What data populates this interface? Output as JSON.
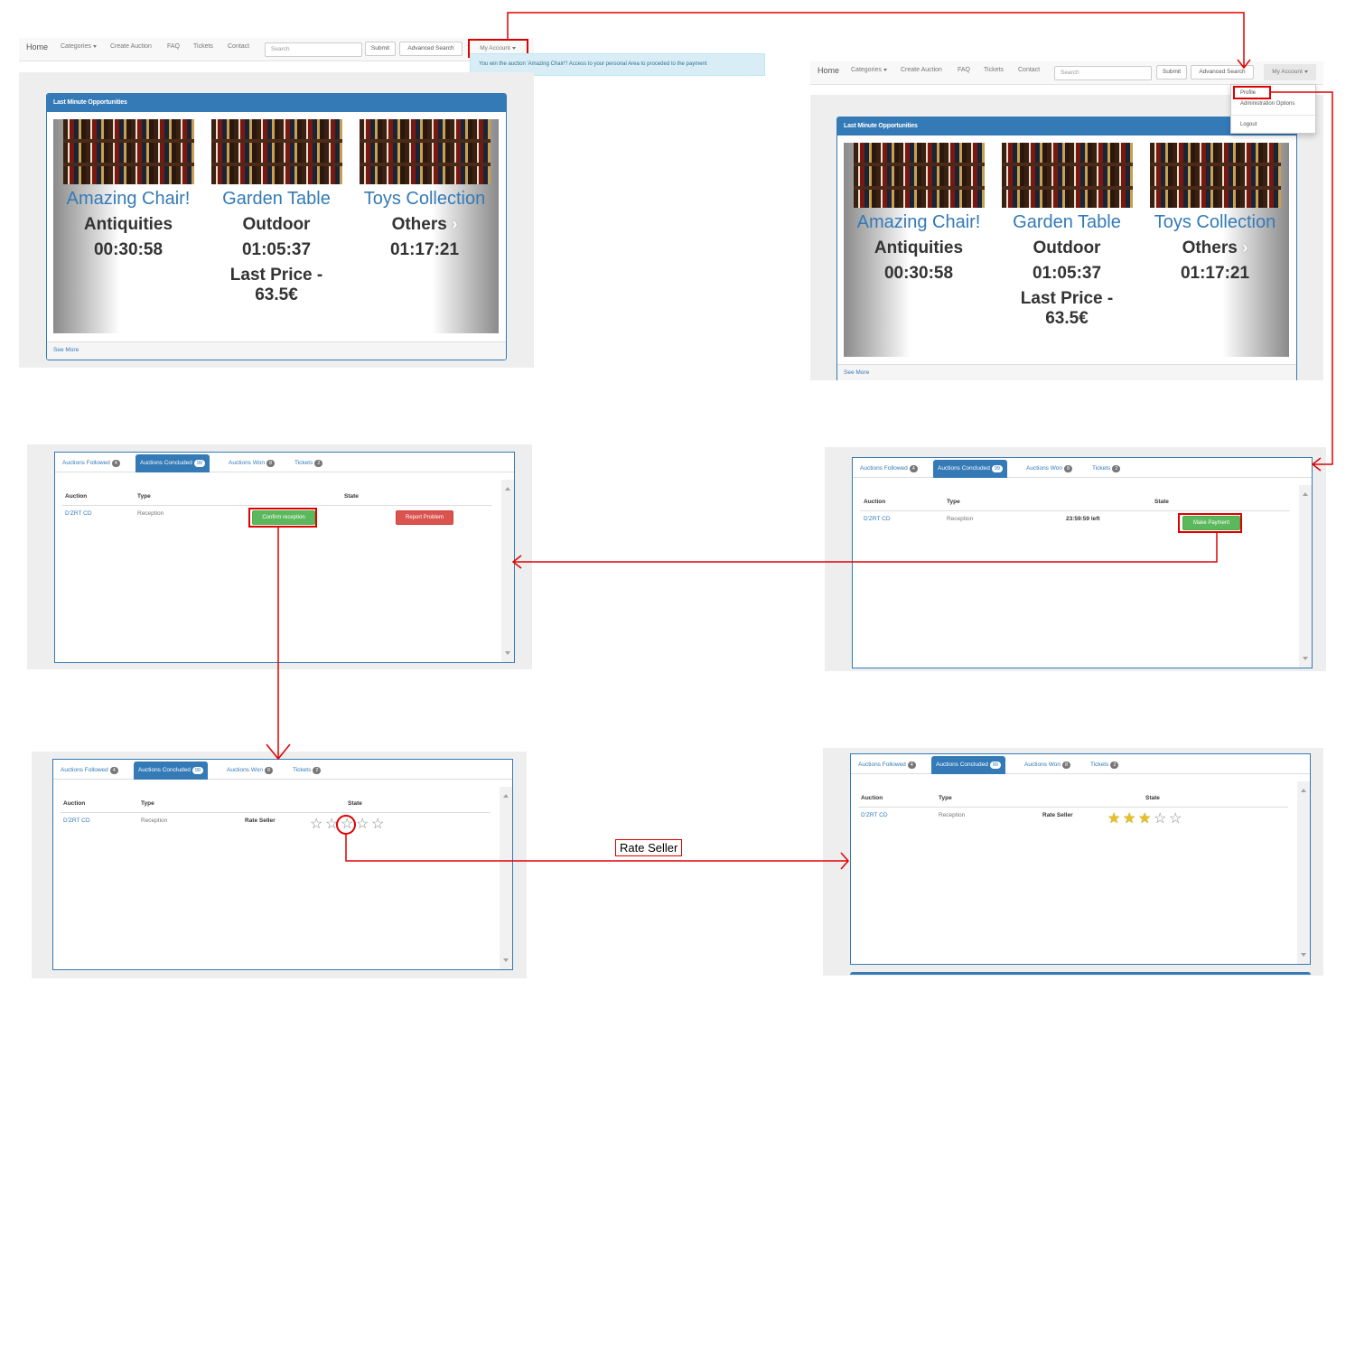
{
  "navbar": {
    "home": "Home",
    "categories": "Categories",
    "create_auction": "Create Auction",
    "faq": "FAQ",
    "tickets": "Tickets",
    "contact": "Contact",
    "search_placeholder": "Search",
    "submit": "Submit",
    "advanced_search": "Advanced Search",
    "my_account": "My Account"
  },
  "alert": {
    "text": "You win the auction 'Amazing Chair!'! Access to your personal Area to proceded to the payment"
  },
  "account_menu": {
    "profile": "Profile",
    "administration": "Administration Options",
    "logout": "Logout"
  },
  "last_minute": {
    "title": "Last Minute Opportunities",
    "see_more": "See More",
    "items": [
      {
        "name": "Amazing Chair!",
        "category": "Antiquities",
        "time_left": "00:30:58",
        "price": ""
      },
      {
        "name": "Garden Table",
        "category": "Outdoor",
        "time_left": "01:05:37",
        "price": "Last Price - 63.5€"
      },
      {
        "name": "Toys Collection",
        "category": "Others",
        "time_left": "01:17:21",
        "price": ""
      }
    ]
  },
  "tabs": {
    "followed": "Auctions Followed",
    "followed_count": "4",
    "concluded": "Auctions Concluded",
    "concluded_count": "99",
    "won": "Auctions Won",
    "won_count": "8",
    "tickets": "Tickets",
    "tickets_count": "2"
  },
  "table": {
    "col_auction": "Auction",
    "col_type": "Type",
    "col_state": "State",
    "row_auction": "D'ZRT CD",
    "row_type": "Reception",
    "time_left": "23:59:59 left",
    "make_payment": "Make Payment",
    "confirm_reception": "Confirm reception",
    "report_problem": "Report Problem",
    "rate_seller": "Rate Seller"
  },
  "rating": {
    "before": 0,
    "after": 3,
    "max": 5
  },
  "annotation": {
    "rate_seller_label": "Rate Seller"
  },
  "colors": {
    "primary": "#337ab7",
    "success": "#5cb85c",
    "danger": "#d9534f",
    "highlight": "#e00000"
  }
}
